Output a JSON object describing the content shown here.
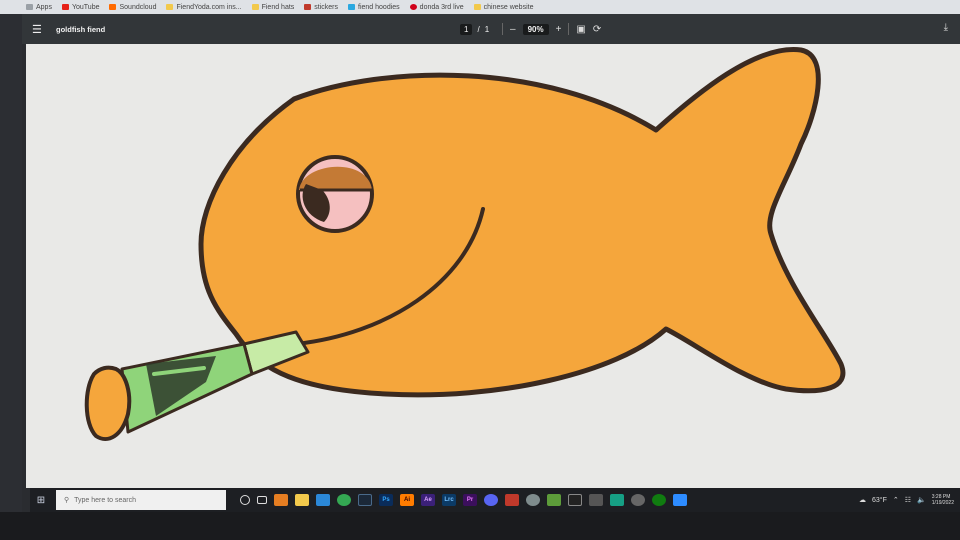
{
  "bookmarks": [
    {
      "label": "Apps",
      "color": "#9aa0a6"
    },
    {
      "label": "YouTube",
      "color": "#e62117"
    },
    {
      "label": "Soundcloud",
      "color": "#ff6a00"
    },
    {
      "label": "FiendYoda.com ins...",
      "color": "#f2c94c"
    },
    {
      "label": "Fiend hats",
      "color": "#f2c94c"
    },
    {
      "label": "stickers",
      "color": "#c0392b"
    },
    {
      "label": "fiend hoodies",
      "color": "#2aa8e0"
    },
    {
      "label": "donda 3rd live",
      "color": "#d0021b"
    },
    {
      "label": "chinese website",
      "color": "#f2c94c"
    }
  ],
  "toolbar": {
    "menu_icon": "hamburger-icon",
    "title": "goldfish fiend",
    "page_current": "1",
    "page_sep": "/",
    "page_total": "1",
    "zoom_out": "–",
    "zoom": "90%",
    "zoom_in": "+",
    "fit_icon": "fit-page-icon",
    "rotate_icon": "rotate-icon",
    "download_icon": "download-icon"
  },
  "taskbar": {
    "search_placeholder": "Type here to search",
    "apps": [
      {
        "icon": "cortana-icon",
        "label": "",
        "color": "#1d1f23"
      },
      {
        "icon": "task-view-icon",
        "label": "",
        "color": "#1d1f23"
      },
      {
        "icon": "app-icon",
        "label": "",
        "color": "#e67e22"
      },
      {
        "icon": "file-explorer-icon",
        "label": "",
        "color": "#f2c94c"
      },
      {
        "icon": "mail-icon",
        "label": "",
        "color": "#2b88d8"
      },
      {
        "icon": "chrome-icon",
        "label": "",
        "color": "#34a853"
      },
      {
        "icon": "steam-icon",
        "label": "",
        "color": "#1b2838"
      },
      {
        "icon": "photoshop-icon",
        "label": "Ps",
        "color": "#0a2c5a"
      },
      {
        "icon": "illustrator-icon",
        "label": "Ai",
        "color": "#ff7c00"
      },
      {
        "icon": "after-effects-icon",
        "label": "Ae",
        "color": "#3b2078"
      },
      {
        "icon": "lightroom-icon",
        "label": "Lrc",
        "color": "#0b3a66"
      },
      {
        "icon": "premiere-icon",
        "label": "Pr",
        "color": "#3b0f5c"
      },
      {
        "icon": "discord-icon",
        "label": "",
        "color": "#5865f2"
      },
      {
        "icon": "app-icon",
        "label": "",
        "color": "#c0392b"
      },
      {
        "icon": "app-icon",
        "label": "",
        "color": "#7f8c8d"
      },
      {
        "icon": "minecraft-icon",
        "label": "",
        "color": "#5d9c3a"
      },
      {
        "icon": "app-icon",
        "label": "",
        "color": "#222"
      },
      {
        "icon": "app-icon",
        "label": "",
        "color": "#555"
      },
      {
        "icon": "app-icon",
        "label": "",
        "color": "#16a085"
      },
      {
        "icon": "app-icon",
        "label": "",
        "color": "#666"
      },
      {
        "icon": "xbox-icon",
        "label": "",
        "color": "#107c10"
      },
      {
        "icon": "zoom-icon",
        "label": "",
        "color": "#2d8cff"
      }
    ],
    "weather": "63°F",
    "clock_time": "3:28 PM",
    "clock_date": "1/19/2022"
  },
  "colors": {
    "fish_body": "#f5a63c",
    "outline": "#3b2a20",
    "eyelid": "#c47a35",
    "eye": "#f5c0c0",
    "cigarette": "#8fd47a",
    "filter": "#c7eba6"
  }
}
